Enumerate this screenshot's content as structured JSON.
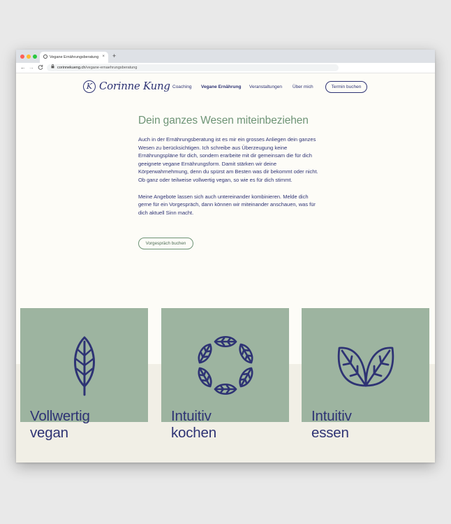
{
  "browser": {
    "tab_title": "Vegane Ernährungsberatung |",
    "tab_close": "×",
    "new_tab": "+",
    "url_domain": "corinnekueng.ch",
    "url_path": "/vegane-ernaehrungsberatung",
    "back": "←",
    "forward": "→",
    "reload": "C"
  },
  "site": {
    "logo_mark": "K",
    "logo_text": "Corinne Kung",
    "nav": [
      "Coaching",
      "Vegane Ernährung",
      "Veranstaltungen",
      "Über mich"
    ],
    "nav_active": "Vegane Ernährung",
    "cta_top": "Termin buchen"
  },
  "intro": {
    "title": "Dein ganzes Wesen miteinbeziehen",
    "paragraph1": "Auch in der Ernährungsberatung ist es mir ein grosses Anliegen dein ganzes Wesen zu berücksichtigen. Ich schreibe aus Überzeugung keine Ernährungspläne für dich, sondern erarbeite mit dir gemeinsam die für dich geeignete vegane Ernährungsform. Damit stärken wir deine Körperwahrnehmung, denn du spürst am Besten was dir bekommt oder nicht. Ob ganz oder teilweise vollwertig vegan, so wie es für dich stimmt.",
    "paragraph2": "Meine Angebote lassen sich auch untereinander kombinieren. Melde dich gerne für ein Vorgespräch, dann können wir miteinander anschauen, was für dich aktuell Sinn macht.",
    "cta": "Vorgespräch buchen"
  },
  "features": [
    {
      "line1": "Vollwertig",
      "line2": "vegan",
      "icon": "leaf-icon"
    },
    {
      "line1": "Intuitiv",
      "line2": "kochen",
      "icon": "leaf-wreath-icon"
    },
    {
      "line1": "Intuitiv",
      "line2": "essen",
      "icon": "twin-leaves-icon"
    }
  ],
  "colors": {
    "navy": "#2e3374",
    "sage": "#9db4a0",
    "green_heading": "#6e9476",
    "cream": "#fdfcf7",
    "band": "#f1efe6"
  }
}
